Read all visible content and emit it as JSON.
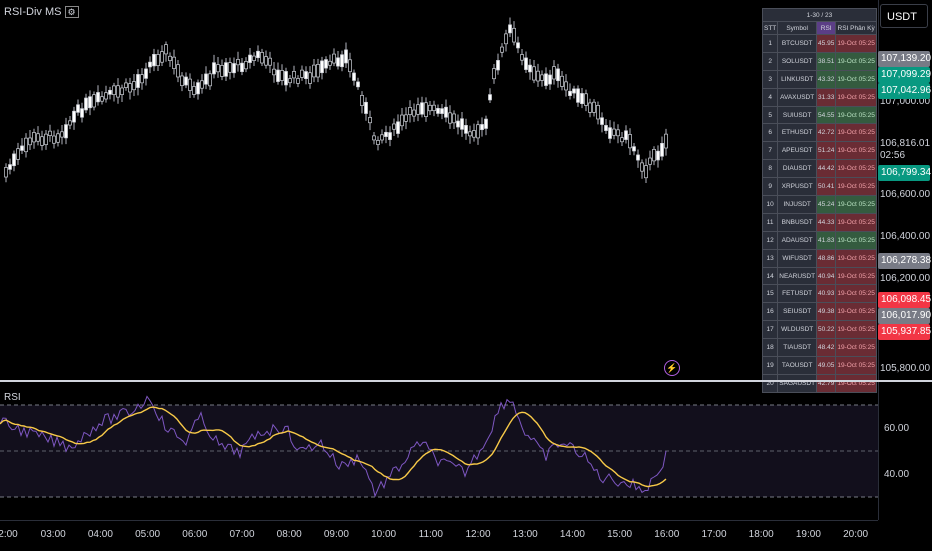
{
  "indicator_title": "RSI-Div MS",
  "rsi_pane_title": "RSI",
  "currency": "USDT",
  "price_ticks": [
    "107,000.00",
    "106,816.01",
    "02:56",
    "106,600.00",
    "106,400.00",
    "106,200.00",
    "105,800.00"
  ],
  "price_badges": [
    {
      "text": "107,139.20",
      "color": "#787b86"
    },
    {
      "text": "107,099.29",
      "color": "#089981"
    },
    {
      "text": "107,042.96",
      "color": "#089981"
    },
    {
      "text": "106,799.34",
      "color": "#089981"
    },
    {
      "text": "106,278.38",
      "color": "#787b86"
    },
    {
      "text": "106,098.45",
      "color": "#f23645"
    },
    {
      "text": "106,017.90",
      "color": "#787b86"
    },
    {
      "text": "105,937.85",
      "color": "#f23645"
    }
  ],
  "rsi_ticks": [
    "60.00",
    "40.00"
  ],
  "time_labels": [
    "2:00",
    "03:00",
    "04:00",
    "05:00",
    "06:00",
    "07:00",
    "08:00",
    "09:00",
    "10:00",
    "11:00",
    "12:00",
    "13:00",
    "14:00",
    "15:00",
    "16:00",
    "17:00",
    "18:00",
    "19:00",
    "20:00"
  ],
  "table": {
    "page": "1-30 / 23",
    "headers": [
      "STT",
      "Symbol",
      "RSI",
      "RSI Phân Kỳ"
    ],
    "rows": [
      {
        "n": "1",
        "sym": "BTCUSDT",
        "rsi": "45.95",
        "div": "19-Oct  05:25",
        "state": "red"
      },
      {
        "n": "2",
        "sym": "SOLUSDT",
        "rsi": "38.51",
        "div": "19-Oct  05:25",
        "state": "green"
      },
      {
        "n": "3",
        "sym": "LINKUSDT",
        "rsi": "43.32",
        "div": "19-Oct  05:25",
        "state": "green"
      },
      {
        "n": "4",
        "sym": "AVAXUSDT",
        "rsi": "31.33",
        "div": "19-Oct  05:25",
        "state": "red"
      },
      {
        "n": "5",
        "sym": "SUIUSDT",
        "rsi": "54.55",
        "div": "19-Oct  05:25",
        "state": "green"
      },
      {
        "n": "6",
        "sym": "ETHUSDT",
        "rsi": "42.72",
        "div": "19-Oct  05:25",
        "state": "red"
      },
      {
        "n": "7",
        "sym": "APEUSDT",
        "rsi": "51.24",
        "div": "19-Oct  05:25",
        "state": "red"
      },
      {
        "n": "8",
        "sym": "DIAUSDT",
        "rsi": "44.42",
        "div": "19-Oct  05:25",
        "state": "red"
      },
      {
        "n": "9",
        "sym": "XRPUSDT",
        "rsi": "50.41",
        "div": "19-Oct  05:25",
        "state": "red"
      },
      {
        "n": "10",
        "sym": "INJUSDT",
        "rsi": "45.24",
        "div": "19-Oct  05:25",
        "state": "green"
      },
      {
        "n": "11",
        "sym": "BNBUSDT",
        "rsi": "44.33",
        "div": "19-Oct  05:25",
        "state": "red"
      },
      {
        "n": "12",
        "sym": "ADAUSDT",
        "rsi": "41.83",
        "div": "19-Oct  05:25",
        "state": "green"
      },
      {
        "n": "13",
        "sym": "WIFUSDT",
        "rsi": "48.86",
        "div": "19-Oct  05:25",
        "state": "red"
      },
      {
        "n": "14",
        "sym": "NEARUSDT",
        "rsi": "40.94",
        "div": "19-Oct  05:25",
        "state": "red"
      },
      {
        "n": "15",
        "sym": "FETUSDT",
        "rsi": "40.93",
        "div": "19-Oct  05:25",
        "state": "red"
      },
      {
        "n": "16",
        "sym": "SEIUSDT",
        "rsi": "49.38",
        "div": "19-Oct  05:25",
        "state": "red"
      },
      {
        "n": "17",
        "sym": "WLDUSDT",
        "rsi": "50.22",
        "div": "19-Oct  05:25",
        "state": "red"
      },
      {
        "n": "18",
        "sym": "TIAUSDT",
        "rsi": "48.42",
        "div": "19-Oct  05:25",
        "state": "red"
      },
      {
        "n": "19",
        "sym": "TAOUSDT",
        "rsi": "49.05",
        "div": "19-Oct  05:25",
        "state": "red"
      },
      {
        "n": "20",
        "sym": "SAGAUSDT",
        "rsi": "42.79",
        "div": "19-Oct  05:25",
        "state": "red"
      }
    ]
  },
  "colors": {
    "green_cell": "#345b3f",
    "red_cell": "#6a2c34",
    "rsi_line": "#7e57c2",
    "rsi_ma": "#f7c948"
  }
}
